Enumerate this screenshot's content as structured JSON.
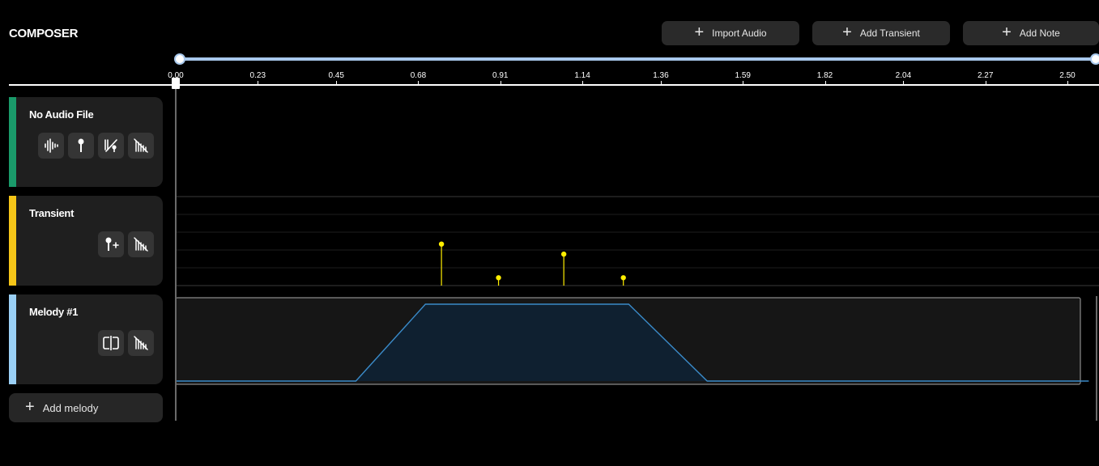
{
  "app": {
    "title": "COMPOSER"
  },
  "toolbar": {
    "import_audio": "Import Audio",
    "add_transient": "Add Transient",
    "add_note": "Add Note",
    "plus": "+"
  },
  "ruler": {
    "ticks": [
      "0.00",
      "0.23",
      "0.45",
      "0.68",
      "0.91",
      "1.14",
      "1.36",
      "1.59",
      "1.82",
      "2.04",
      "2.27",
      "2.50"
    ]
  },
  "tracks": {
    "audio": {
      "name": "No Audio File",
      "color": "#1a9a6a",
      "icons": [
        "waveform-icon",
        "pin-icon",
        "transient-detect-icon",
        "disable-haptic-icon"
      ]
    },
    "transient": {
      "name": "Transient",
      "color": "#f5c518",
      "icons": [
        "add-pin-icon",
        "disable-haptic-icon"
      ],
      "points": [
        {
          "time": 0.745,
          "value": 0.95
        },
        {
          "time": 0.905,
          "value": 0.18
        },
        {
          "time": 1.088,
          "value": 0.72
        },
        {
          "time": 1.255,
          "value": 0.18
        }
      ]
    },
    "melody": {
      "name": "Melody #1",
      "color": "#9ad0f5",
      "icons": [
        "split-icon",
        "disable-haptic-icon"
      ],
      "envelope": [
        {
          "time": 0.0,
          "value": 0.0
        },
        {
          "time": 0.505,
          "value": 0.0
        },
        {
          "time": 0.7,
          "value": 1.0
        },
        {
          "time": 1.27,
          "value": 1.0
        },
        {
          "time": 1.49,
          "value": 0.0
        },
        {
          "time": 2.56,
          "value": 0.0
        }
      ]
    }
  },
  "add_melody": {
    "label": "Add melody",
    "plus": "+"
  },
  "colors": {
    "accent": "#a8c8ec",
    "transient_point": "#ffee00",
    "melody_line": "#3a8ac8",
    "melody_fill": "#0f2030"
  }
}
